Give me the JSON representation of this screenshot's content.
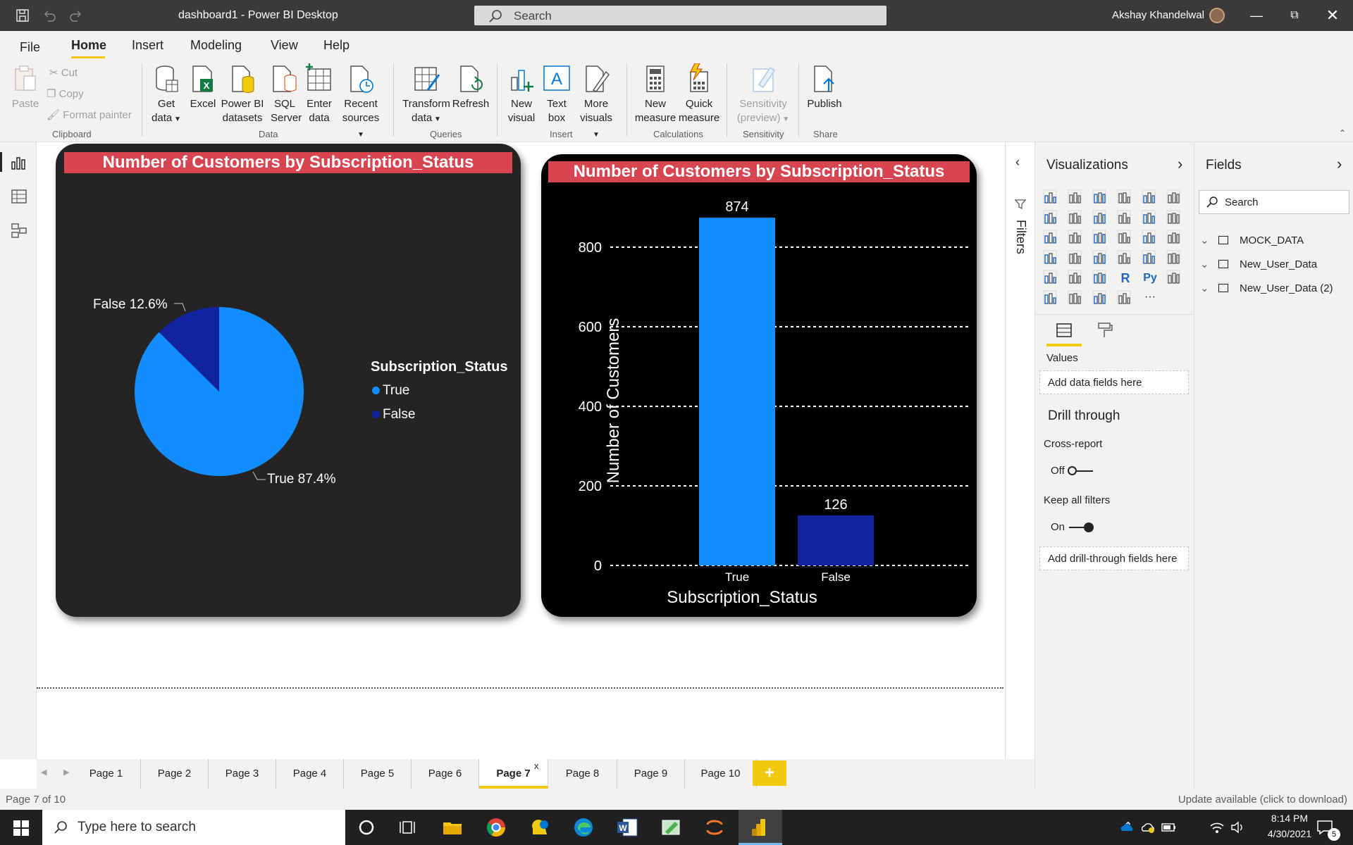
{
  "titlebar": {
    "title": "dashboard1 - Power BI Desktop",
    "search": "Search",
    "user": "Akshay Khandelwal"
  },
  "menu": {
    "file": "File",
    "home": "Home",
    "insert": "Insert",
    "modeling": "Modeling",
    "view": "View",
    "help": "Help"
  },
  "ribbon": {
    "paste": "Paste",
    "cut": "Cut",
    "copy": "Copy",
    "format_painter": "Format painter",
    "get_data_1": "Get",
    "get_data_2": "data",
    "excel": "Excel",
    "pbi_1": "Power BI",
    "pbi_2": "datasets",
    "sql_1": "SQL",
    "sql_2": "Server",
    "enter_1": "Enter",
    "enter_2": "data",
    "recent_1": "Recent",
    "recent_2": "sources",
    "transform_1": "Transform",
    "transform_2": "data",
    "refresh": "Refresh",
    "newvisual_1": "New",
    "newvisual_2": "visual",
    "textbox_1": "Text",
    "textbox_2": "box",
    "more_1": "More",
    "more_2": "visuals",
    "newmeasure_1": "New",
    "newmeasure_2": "measure",
    "quick_1": "Quick",
    "quick_2": "measure",
    "sens_1": "Sensitivity",
    "sens_2": "(preview)",
    "publish": "Publish",
    "groups": {
      "clipboard": "Clipboard",
      "data": "Data",
      "queries": "Queries",
      "insert": "Insert",
      "calculations": "Calculations",
      "sensitivity": "Sensitivity",
      "share": "Share"
    }
  },
  "pie_visual": {
    "title": "Number of Customers by Subscription_Status",
    "legend_title": "Subscription_Status",
    "label_false": "False 12.6%",
    "label_true": "True 87.4%",
    "legend": [
      "True",
      "False"
    ]
  },
  "bar_visual": {
    "title": "Number of Customers by Subscription_Status",
    "ylabel": "Number of Customers",
    "xlabel": "Subscription_Status",
    "label_true": "874",
    "label_false": "126"
  },
  "chart_data": [
    {
      "type": "pie",
      "title": "Number of Customers by Subscription_Status",
      "categories": [
        "True",
        "False"
      ],
      "values": [
        87.4,
        12.6
      ],
      "colors": [
        "#118dff",
        "#12239e"
      ],
      "legend_title": "Subscription_Status",
      "legend_placement": "right"
    },
    {
      "type": "bar",
      "title": "Number of Customers by Subscription_Status",
      "categories": [
        "True",
        "False"
      ],
      "values": [
        874,
        126
      ],
      "colors": [
        "#118dff",
        "#12239e"
      ],
      "xlabel": "Subscription_Status",
      "ylabel": "Number of Customers",
      "ylim": [
        0,
        900
      ],
      "yticks": [
        0,
        200,
        400,
        600,
        800
      ],
      "grid": true
    }
  ],
  "filters_label": "Filters",
  "viz_pane": {
    "title": "Visualizations",
    "values_label": "Values",
    "add_data": "Add data fields here",
    "drill_title": "Drill through",
    "cross_report": "Cross-report",
    "off": "Off",
    "keep_filters": "Keep all filters",
    "on": "On",
    "add_drill": "Add drill-through fields here",
    "more": "···",
    "r_label": "R",
    "py_label": "Py"
  },
  "fields_pane": {
    "title": "Fields",
    "search": "Search",
    "tables": [
      "MOCK_DATA",
      "New_User_Data",
      "New_User_Data (2)"
    ]
  },
  "tabs": [
    "Page 1",
    "Page 2",
    "Page 3",
    "Page 4",
    "Page 5",
    "Page 6",
    "Page 7",
    "Page 8",
    "Page 9",
    "Page 10"
  ],
  "tab_close": "x",
  "add_page": "+",
  "status": {
    "page": "Page 7 of 10",
    "update": "Update available (click to download)"
  },
  "taskbar": {
    "search": "Type here to search",
    "time": "8:14 PM",
    "date": "4/30/2021",
    "badge": "5"
  },
  "colors": {
    "accent": "#f2c811",
    "title_bar_red": "#d64550",
    "series_true": "#118dff",
    "series_false": "#12239e"
  }
}
